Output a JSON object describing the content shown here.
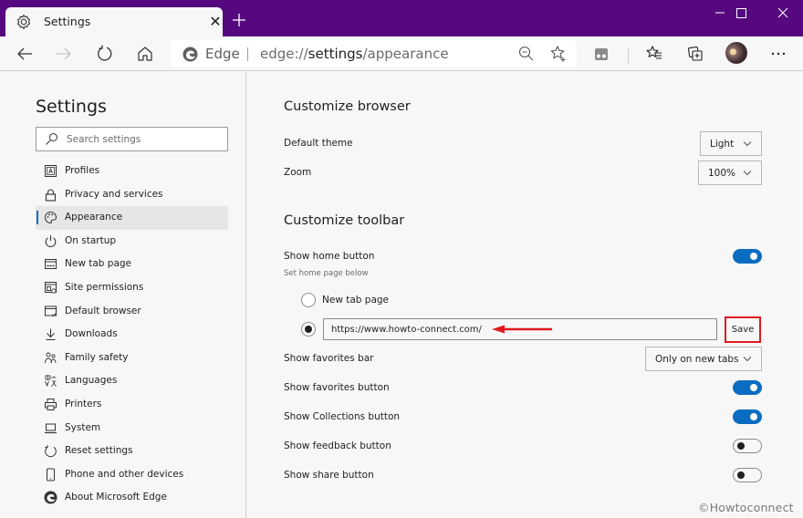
{
  "window": {
    "tab_title": "Settings",
    "tab_icon": "gear-icon",
    "new_tab_icon": "plus-icon",
    "controls": [
      "minimize-icon",
      "maximize-icon",
      "close-icon"
    ],
    "accent_color": "#56097e"
  },
  "toolbar": {
    "address_site": "Edge",
    "address_url_prefix": "edge://",
    "address_url_main": "settings",
    "address_url_suffix": "/appearance"
  },
  "sidebar": {
    "title": "Settings",
    "search_placeholder": "Search settings",
    "items": [
      {
        "label": "Profiles",
        "icon": "profile-icon",
        "active": false
      },
      {
        "label": "Privacy and services",
        "icon": "lock-icon",
        "active": false
      },
      {
        "label": "Appearance",
        "icon": "palette-icon",
        "active": true
      },
      {
        "label": "On startup",
        "icon": "power-icon",
        "active": false
      },
      {
        "label": "New tab page",
        "icon": "new-tab-page-icon",
        "active": false
      },
      {
        "label": "Site permissions",
        "icon": "site-permissions-icon",
        "active": false
      },
      {
        "label": "Default browser",
        "icon": "default-browser-icon",
        "active": false
      },
      {
        "label": "Downloads",
        "icon": "download-icon",
        "active": false
      },
      {
        "label": "Family safety",
        "icon": "family-icon",
        "active": false
      },
      {
        "label": "Languages",
        "icon": "languages-icon",
        "active": false
      },
      {
        "label": "Printers",
        "icon": "printer-icon",
        "active": false
      },
      {
        "label": "System",
        "icon": "laptop-icon",
        "active": false
      },
      {
        "label": "Reset settings",
        "icon": "reset-icon",
        "active": false
      },
      {
        "label": "Phone and other devices",
        "icon": "phone-icon",
        "active": false
      },
      {
        "label": "About Microsoft Edge",
        "icon": "edge-logo-icon",
        "active": false
      }
    ]
  },
  "main": {
    "customize_browser": {
      "title": "Customize browser",
      "default_theme_label": "Default theme",
      "default_theme_value": "Light",
      "zoom_label": "Zoom",
      "zoom_value": "100%"
    },
    "customize_toolbar": {
      "title": "Customize toolbar",
      "show_home_button_label": "Show home button",
      "show_home_button_on": true,
      "home_sublabel": "Set home page below",
      "radio_new_tab_label": "New tab page",
      "radio_new_tab_checked": false,
      "radio_url_checked": true,
      "home_url_value": "https://www.howto-connect.com/",
      "save_label": "Save",
      "show_favorites_bar_label": "Show favorites bar",
      "show_favorites_bar_value": "Only on new tabs",
      "toggles": [
        {
          "label": "Show favorites button",
          "on": true
        },
        {
          "label": "Show Collections button",
          "on": true
        },
        {
          "label": "Show feedback button",
          "on": false
        },
        {
          "label": "Show share button",
          "on": false
        }
      ]
    },
    "watermark": "©Howtoconnect",
    "toggle_on_color": "#0a6dc2",
    "highlight_color": "#e0191e"
  }
}
